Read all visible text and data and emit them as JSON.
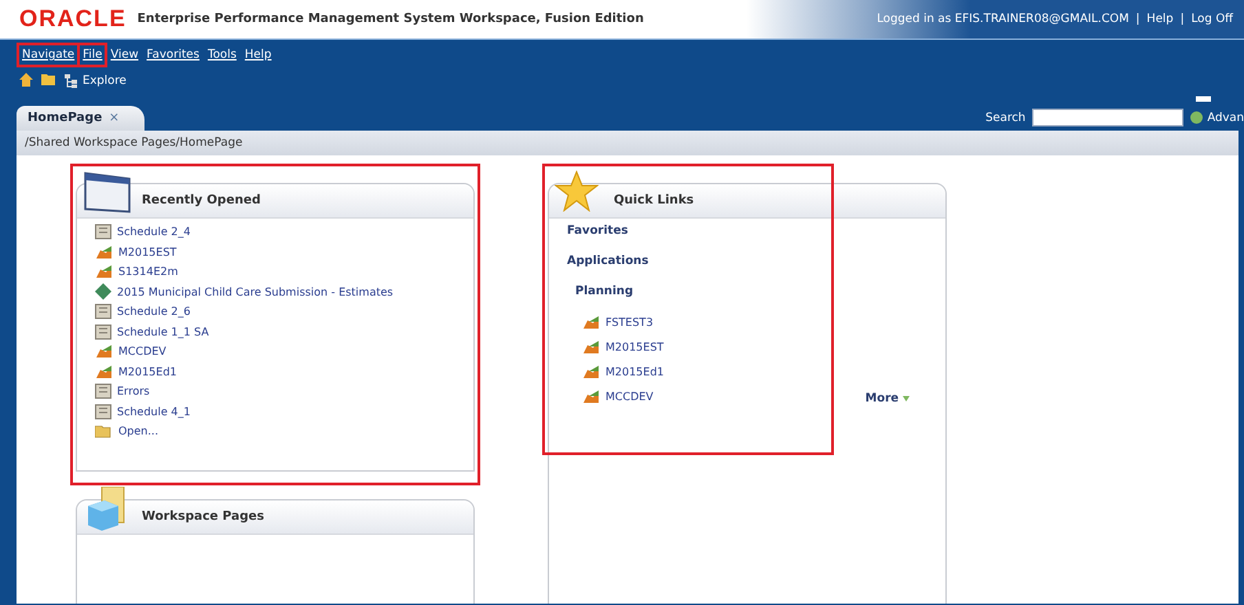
{
  "header": {
    "logo": "ORACLE",
    "title": "Enterprise Performance Management System Workspace, Fusion Edition",
    "user": "Logged in as EFIS.TRAINER08@GMAIL.COM",
    "links": [
      "Help",
      "Log Off"
    ],
    "separator": "|"
  },
  "menu": [
    {
      "label": "Navigate",
      "highlighted": true
    },
    {
      "label": "File",
      "highlighted": true
    },
    {
      "label": "View",
      "highlighted": false
    },
    {
      "label": "Favorites",
      "highlighted": false
    },
    {
      "label": "Tools",
      "highlighted": false
    },
    {
      "label": "Help",
      "highlighted": false
    }
  ],
  "toolbar": {
    "explore": "Explore"
  },
  "tabs": [
    {
      "label": "HomePage",
      "selected": true,
      "close": "×"
    }
  ],
  "search": {
    "label": "Search",
    "advanced": "Advan"
  },
  "breadcrumb": "/Shared Workspace Pages/HomePage",
  "recently_opened": {
    "title": "Recently Opened",
    "highlighted": true,
    "items": [
      {
        "kind": "doc",
        "label": "Schedule 2_4"
      },
      {
        "kind": "app",
        "label": "M2015EST"
      },
      {
        "kind": "app",
        "label": "S1314E2m"
      },
      {
        "kind": "form",
        "label": "2015 Municipal Child Care Submission - Estimates"
      },
      {
        "kind": "doc",
        "label": "Schedule 2_6"
      },
      {
        "kind": "doc",
        "label": "Schedule 1_1 SA"
      },
      {
        "kind": "app",
        "label": "MCCDEV"
      },
      {
        "kind": "app",
        "label": "M2015Ed1"
      },
      {
        "kind": "doc",
        "label": "Errors"
      },
      {
        "kind": "doc",
        "label": "Schedule 4_1"
      },
      {
        "kind": "open",
        "label": "Open..."
      }
    ]
  },
  "quick_links": {
    "title": "Quick Links",
    "highlighted": true,
    "sections": [
      "Favorites",
      "Applications"
    ],
    "group": "Planning",
    "items": [
      {
        "kind": "app",
        "label": "FSTEST3"
      },
      {
        "kind": "app",
        "label": "M2015EST"
      },
      {
        "kind": "app",
        "label": "M2015Ed1"
      },
      {
        "kind": "app",
        "label": "MCCDEV"
      }
    ],
    "more": "More"
  },
  "workspace_pages": {
    "title": "Workspace Pages"
  }
}
